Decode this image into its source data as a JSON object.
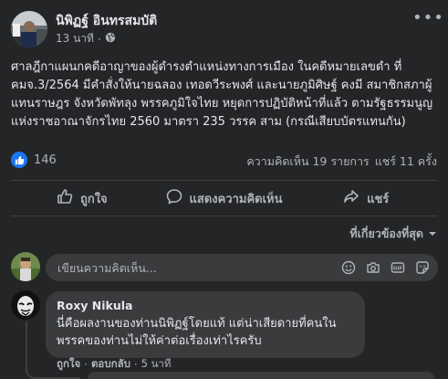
{
  "post": {
    "author": "นิพิฏฐ์ อินทรสมบัติ",
    "time": "13 นาที",
    "text": "ศาลฎีกาแผนกคดีอาญาของผู้ดำรงตำแหน่งทางการเมือง ในคดีหมายเลขดำ ที่ คมจ.3/2564  มีคำสั่งให้นายฉลอง เทอดวีระพงศ์  และนายภูมิศิษฐ์ คงมี สมาชิกสภาผู้แทนราษฎร จังหวัดพัทลุง พรรคภูมิใจไทย หยุดการปฏิบัติหน้าที่แล้ว ตามรัฐธรรมนูญแห่งราชอาณาจักรไทย 2560 มาตรา 235 วรรค สาม (กรณีเสียบบัตรแทนกัน)",
    "reaction_count": "146",
    "comments_count": "ความคิดเห็น 19 รายการ",
    "shares_count": "แชร์ 11 ครั้ง"
  },
  "actions": {
    "like": "ถูกใจ",
    "comment": "แสดงความคิดเห็น",
    "share": "แชร์"
  },
  "sort": {
    "label": "ที่เกี่ยวข้องที่สุด"
  },
  "comment_box": {
    "placeholder": "เขียนความคิดเห็น..."
  },
  "comment": {
    "author": "Roxy Nikula",
    "text": "นี่คือผลงานของท่านนิพิฏฐ์โดยแท้ แต่น่าเสียดายที่คนในพรรคของท่านไม่ให้ค่าต่อเรื่องเท่าไรครับ",
    "like": "ถูกใจ",
    "reply": "ตอบกลับ",
    "time": "5 นาที"
  },
  "icons": {
    "privacy": "globe-icon",
    "menu": "more-options-icon",
    "reaction": "like-icon",
    "emoji": "emoji-icon",
    "camera": "camera-icon",
    "gif": "gif-icon",
    "sticker": "sticker-icon"
  },
  "colors": {
    "background": "#242526",
    "bubble": "#3a3b3c",
    "accent": "#1877f2",
    "text": "#e4e6eb",
    "secondary": "#b0b3b8"
  }
}
